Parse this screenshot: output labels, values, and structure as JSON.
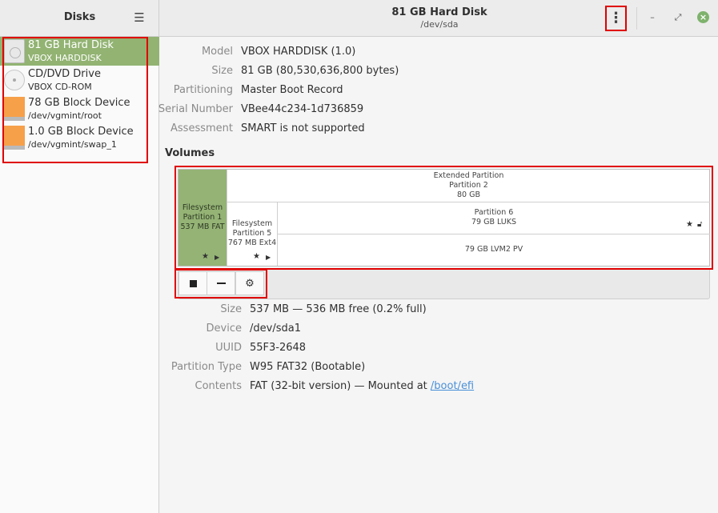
{
  "sidebar": {
    "title": "Disks",
    "drives": [
      {
        "name": "81 GB Hard Disk",
        "sub": "VBOX HARDDISK"
      },
      {
        "name": "CD/DVD Drive",
        "sub": "VBOX CD-ROM"
      },
      {
        "name": "78 GB Block Device",
        "sub": "/dev/vgmint/root"
      },
      {
        "name": "1.0 GB Block Device",
        "sub": "/dev/vgmint/swap_1"
      }
    ]
  },
  "header": {
    "title": "81 GB Hard Disk",
    "subtitle": "/dev/sda"
  },
  "disk_info": {
    "model_label": "Model",
    "model": "VBOX HARDDISK (1.0)",
    "size_label": "Size",
    "size": "81 GB (80,530,636,800 bytes)",
    "partitioning_label": "Partitioning",
    "partitioning": "Master Boot Record",
    "serial_label": "Serial Number",
    "serial": "VBee44c234-1d736859",
    "assessment_label": "Assessment",
    "assessment": "SMART is not supported"
  },
  "volumes": {
    "title": "Volumes",
    "fs1": {
      "line1": "Filesystem",
      "line2": "Partition 1",
      "line3": "537 MB FAT"
    },
    "extended": {
      "line1": "Extended Partition",
      "line2": "Partition 2",
      "line3": "80 GB"
    },
    "p5": {
      "line1": "Filesystem",
      "line2": "Partition 5",
      "line3": "767 MB Ext4"
    },
    "p6": {
      "line1": "Partition 6",
      "line2": "79 GB LUKS"
    },
    "lvm": {
      "line1": "79 GB LVM2 PV"
    }
  },
  "partition_info": {
    "size_label": "Size",
    "size": "537 MB — 536 MB free (0.2% full)",
    "device_label": "Device",
    "device": "/dev/sda1",
    "uuid_label": "UUID",
    "uuid": "55F3-2648",
    "type_label": "Partition Type",
    "type": "W95 FAT32 (Bootable)",
    "contents_label": "Contents",
    "contents_prefix": "FAT (32-bit version) — Mounted at ",
    "mount_point": "/boot/efi"
  },
  "colors": {
    "accent": "#92b372",
    "highlight": "#e00000",
    "block_device": "#f6a04a"
  }
}
